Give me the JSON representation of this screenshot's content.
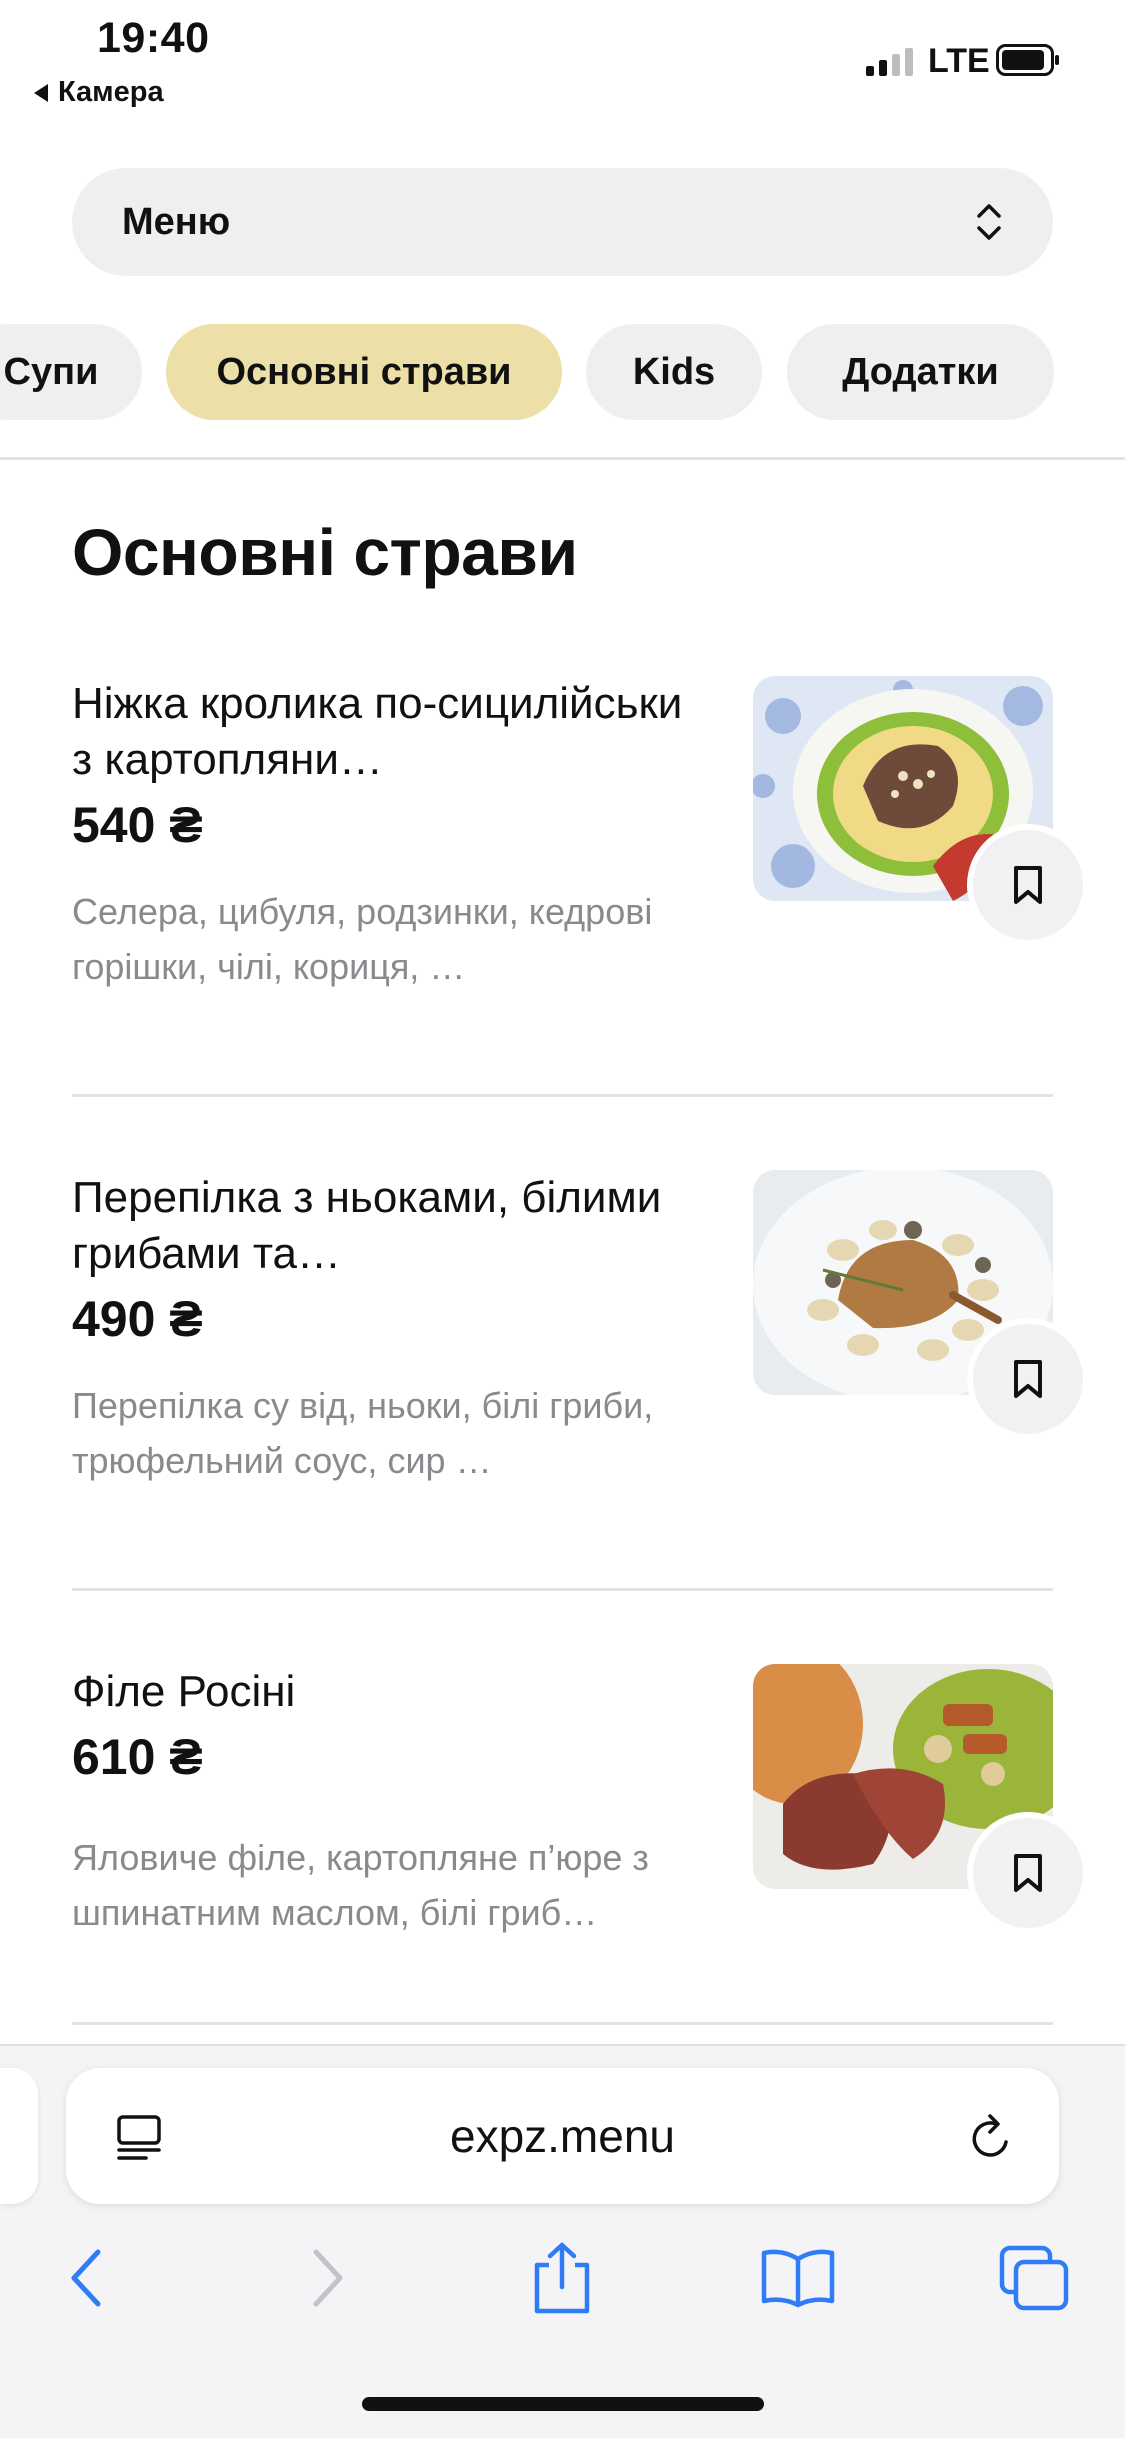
{
  "status_bar": {
    "time": "19:40",
    "back_app": "Камера",
    "network": "LTE",
    "signal_icon": "cellular-signal-icon",
    "battery_icon": "battery-icon"
  },
  "menu_selector": {
    "label": "Меню",
    "icon": "chevron-up-down-icon"
  },
  "tabs": [
    {
      "label": "Супи",
      "active": false
    },
    {
      "label": "Основні страви",
      "active": true
    },
    {
      "label": "Kids",
      "active": false
    },
    {
      "label": "Додатки",
      "active": false
    }
  ],
  "section": {
    "title": "Основні страви"
  },
  "items": [
    {
      "name": "Ніжка кролика по-сицилійськи з картопляни…",
      "price": "540 ₴",
      "description": "Селера, цибуля, родзинки, кедрові горішки, чілі, кориця, …"
    },
    {
      "name": "Перепілка з ньоками, білими грибами та…",
      "price": "490 ₴",
      "description": "Перепілка су від, ньоки, білі гриби, трюфельний соус, сир …"
    },
    {
      "name": "Філе Росіні",
      "price": "610 ₴",
      "description": "Яловиче філе, картопляне п’юре з шпинатним маслом, білі гриб…"
    }
  ],
  "browser": {
    "url": "expz.menu",
    "reader_icon": "page-menu-icon",
    "reload_icon": "reload-icon",
    "toolbar": [
      "back-icon",
      "forward-icon",
      "share-icon",
      "bookmarks-icon",
      "tabs-icon"
    ]
  },
  "colors": {
    "active_tab": "#ece0a8",
    "pill_bg": "#eeeff1",
    "accent_blue": "#2f7cf6",
    "muted_text": "#8a8a8e"
  }
}
